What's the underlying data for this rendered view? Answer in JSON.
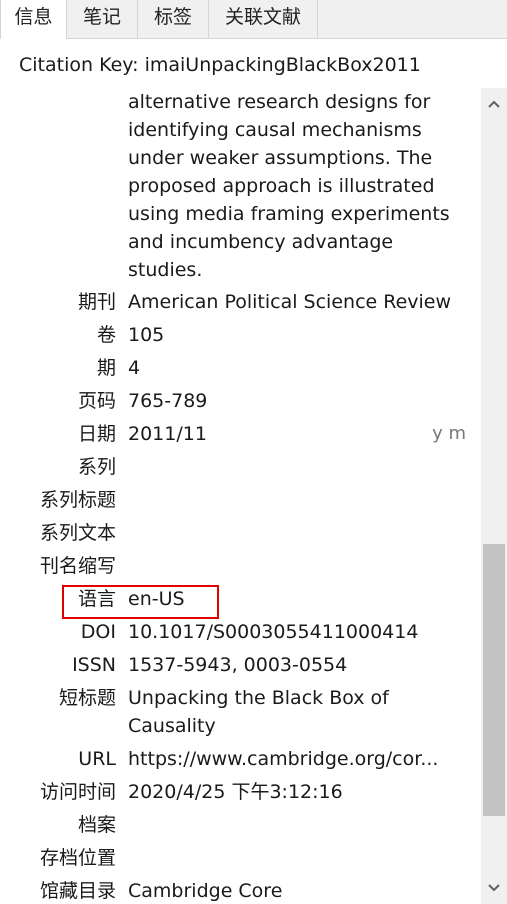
{
  "tabs": [
    "信息",
    "笔记",
    "标签",
    "关联文献"
  ],
  "citation": "Citation Key: imaiUnpackingBlackBox2011",
  "abstract_lines": [
    "alternative research designs for",
    "identifying causal mechanisms",
    "under weaker assumptions. The",
    "proposed approach is illustrated",
    "using media framing experiments",
    "and incumbency advantage",
    "studies."
  ],
  "fields": {
    "journal": {
      "label": "期刊",
      "value": "American Political Science Review"
    },
    "volume": {
      "label": "卷",
      "value": "105"
    },
    "issue": {
      "label": "期",
      "value": "4"
    },
    "pages": {
      "label": "页码",
      "value": "765-789"
    },
    "date": {
      "label": "日期",
      "value": "2011/11",
      "suffix": "y m"
    },
    "series": {
      "label": "系列",
      "value": ""
    },
    "series_title": {
      "label": "系列标题",
      "value": ""
    },
    "series_text": {
      "label": "系列文本",
      "value": ""
    },
    "journal_abbr": {
      "label": "刊名缩写",
      "value": ""
    },
    "language": {
      "label": "语言",
      "value": "en-US"
    },
    "doi": {
      "label": "DOI",
      "value": "10.1017/S0003055411000414"
    },
    "issn": {
      "label": "ISSN",
      "value": "1537-5943, 0003-0554"
    },
    "short_title": {
      "label": "短标题",
      "value_lines": [
        "Unpacking the Black Box of",
        "Causality"
      ]
    },
    "url": {
      "label": "URL",
      "value": "https://www.cambridge.org/cor..."
    },
    "accessed": {
      "label": "访问时间",
      "value": "2020/4/25 下午3:12:16"
    },
    "archive": {
      "label": "档案",
      "value": ""
    },
    "archive_location": {
      "label": "存档位置",
      "value": ""
    },
    "library_catalog": {
      "label": "馆藏目录",
      "value": "Cambridge Core"
    }
  },
  "colors": {
    "highlight_box": "#e00000",
    "tabbar_bg": "#f0f0f0",
    "scroll_thumb": "#c2c2c2"
  },
  "icons": {
    "scroll_up": "chevron-up-icon",
    "scroll_down": "chevron-down-icon"
  }
}
